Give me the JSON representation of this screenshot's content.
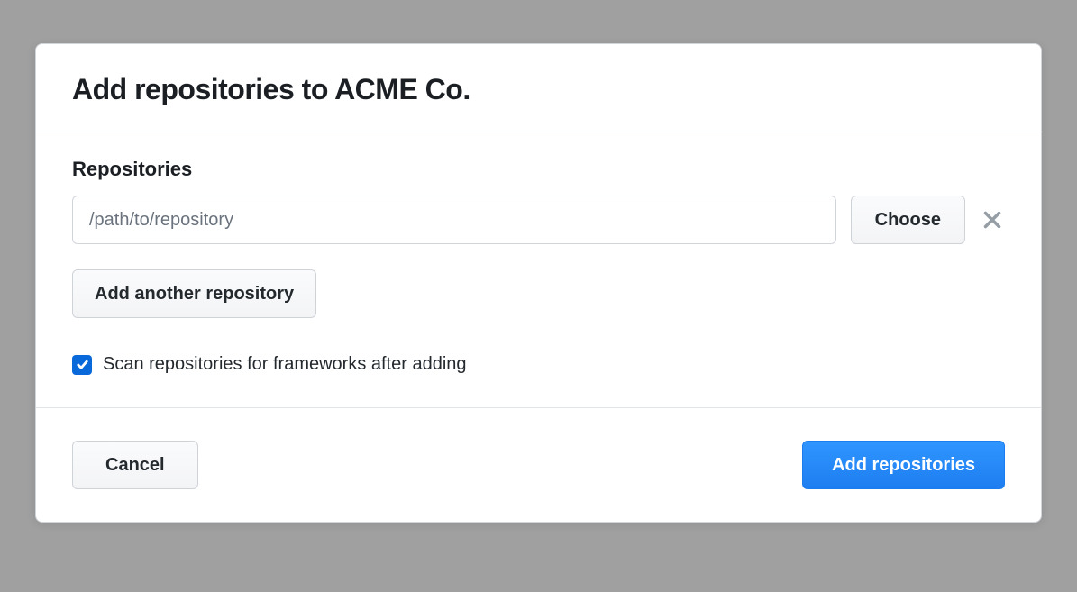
{
  "dialog": {
    "title": "Add repositories to ACME Co."
  },
  "form": {
    "section_label": "Repositories",
    "path_placeholder": "/path/to/repository",
    "path_value": "",
    "choose_label": "Choose",
    "add_another_label": "Add another repository",
    "scan_checkbox_label": "Scan repositories for frameworks after adding",
    "scan_checked": true
  },
  "footer": {
    "cancel_label": "Cancel",
    "submit_label": "Add repositories"
  }
}
